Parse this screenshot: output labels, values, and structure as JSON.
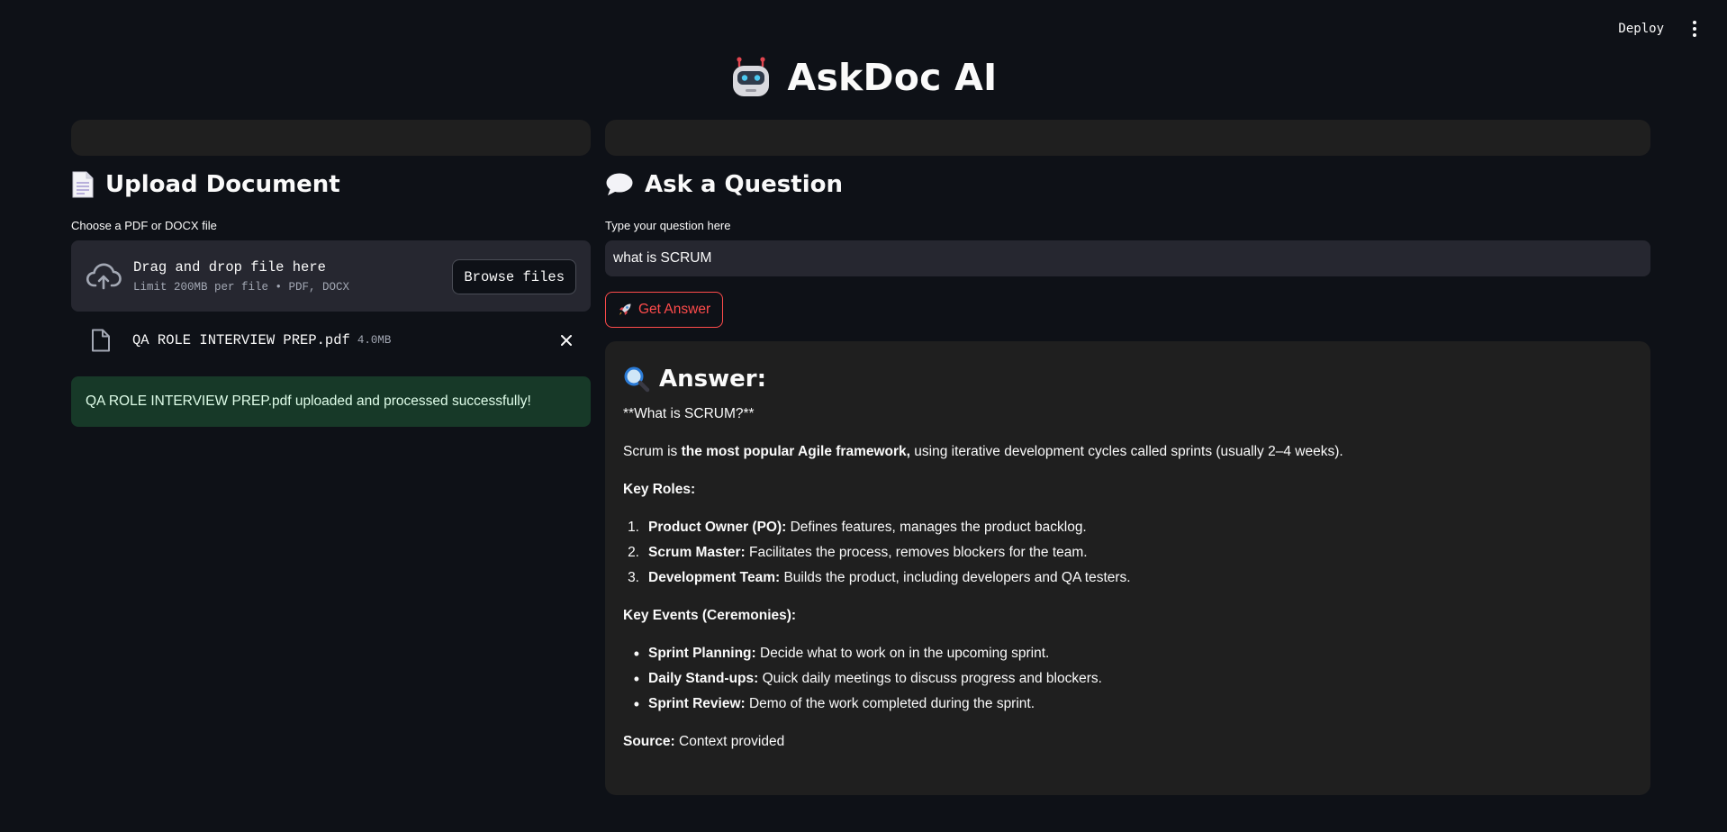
{
  "toolbar": {
    "deploy_label": "Deploy"
  },
  "header": {
    "title": "AskDoc AI"
  },
  "upload": {
    "heading": "Upload Document",
    "field_label": "Choose a PDF or DOCX file",
    "drop_text": "Drag and drop file here",
    "limit_text": "Limit 200MB per file • PDF, DOCX",
    "browse_label": "Browse files",
    "file_name": "QA ROLE INTERVIEW PREP.pdf",
    "file_size": "4.0MB",
    "success_message": "QA ROLE INTERVIEW PREP.pdf uploaded and processed successfully!"
  },
  "question": {
    "heading": "Ask a Question",
    "field_label": "Type your question here",
    "value": "what is SCRUM",
    "button_label": "Get Answer"
  },
  "answer": {
    "heading": "Answer:",
    "title_line": "**What is SCRUM?**",
    "intro_prefix": "Scrum is ",
    "intro_bold": "the most popular Agile framework,",
    "intro_suffix": " using iterative development cycles called sprints (usually 2–4 weeks).",
    "roles_heading": "Key Roles:",
    "roles": [
      {
        "num": "1.",
        "bold": "Product Owner (PO):",
        "text": " Defines features, manages the product backlog."
      },
      {
        "num": "2.",
        "bold": "Scrum Master:",
        "text": " Facilitates the process, removes blockers for the team."
      },
      {
        "num": "3.",
        "bold": "Development Team:",
        "text": " Builds the product, including developers and QA testers."
      }
    ],
    "events_heading": "Key Events (Ceremonies):",
    "events": [
      {
        "bold": "Sprint Planning:",
        "text": " Decide what to work on in the upcoming sprint."
      },
      {
        "bold": "Daily Stand-ups:",
        "text": " Quick daily meetings to discuss progress and blockers."
      },
      {
        "bold": "Sprint Review:",
        "text": " Demo of the work completed during the sprint."
      }
    ],
    "source_label": "Source:",
    "source_text": " Context provided"
  },
  "colors": {
    "background": "#0e1117",
    "panel": "#1f1f1f",
    "input": "#262730",
    "accent": "#ff4b4b",
    "success_bg": "#173928"
  },
  "icons": [
    "robot-icon",
    "document-icon",
    "speech-bubble-icon",
    "cloud-upload-icon",
    "file-icon",
    "close-icon",
    "rocket-icon",
    "magnifier-icon",
    "kebab-menu-icon"
  ]
}
